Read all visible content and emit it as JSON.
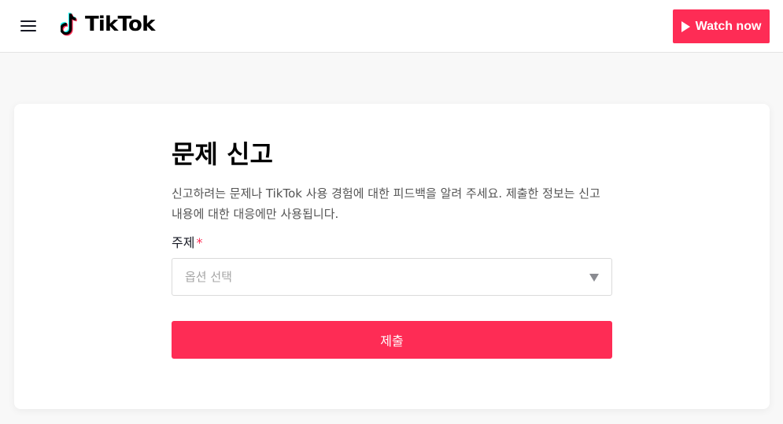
{
  "header": {
    "brand": "TikTok",
    "watch_button_label": "Watch now",
    "icons": {
      "menu": "hamburger-menu-icon",
      "logo": "tiktok-note-logo",
      "play": "play-icon"
    }
  },
  "form": {
    "title": "문제 신고",
    "description": "신고하려는 문제나 TikTok 사용 경험에 대한 피드백을 알려 주세요. 제출한 정보는 신고 내용에 대한 대응에만 사용됩니다.",
    "subject_label": "주제",
    "required_mark": "*",
    "subject_placeholder": "옵션 선택",
    "submit_label": "제출"
  },
  "colors": {
    "accent": "#fe2c55",
    "logo_cyan": "#25f4ee",
    "logo_red": "#fe2c55",
    "text_primary": "#161823",
    "text_secondary": "#545454",
    "placeholder": "#a5a5a5",
    "background": "#f8f8f8"
  }
}
